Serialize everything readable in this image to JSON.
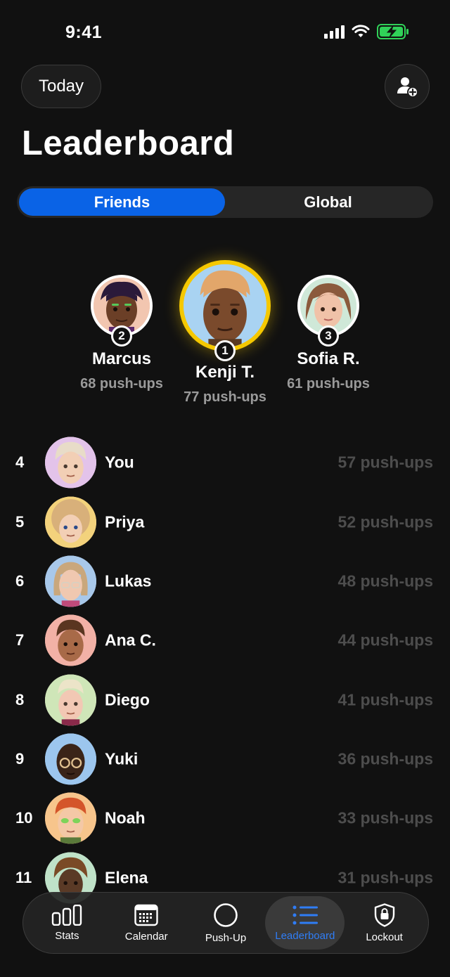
{
  "status_bar": {
    "time": "9:41"
  },
  "header": {
    "today_label": "Today",
    "title": "Leaderboard"
  },
  "segments": {
    "friends": "Friends",
    "global": "Global",
    "active": "Friends"
  },
  "podium": {
    "first": {
      "rank": "1",
      "name": "Kenji T.",
      "score": "77 push-ups"
    },
    "second": {
      "rank": "2",
      "name": "Marcus",
      "score": "68 push-ups"
    },
    "third": {
      "rank": "3",
      "name": "Sofia R.",
      "score": "61 push-ups"
    }
  },
  "list": [
    {
      "rank": "4",
      "name": "You",
      "score": "57 push-ups"
    },
    {
      "rank": "5",
      "name": "Priya",
      "score": "52 push-ups"
    },
    {
      "rank": "6",
      "name": "Lukas",
      "score": "48 push-ups"
    },
    {
      "rank": "7",
      "name": "Ana C.",
      "score": "44 push-ups"
    },
    {
      "rank": "8",
      "name": "Diego",
      "score": "41 push-ups"
    },
    {
      "rank": "9",
      "name": "Yuki",
      "score": "36 push-ups"
    },
    {
      "rank": "10",
      "name": "Noah",
      "score": "33 push-ups"
    },
    {
      "rank": "11",
      "name": "Elena",
      "score": "31 push-ups"
    }
  ],
  "tabs": [
    {
      "label": "Stats",
      "icon": "bar-chart-icon"
    },
    {
      "label": "Calendar",
      "icon": "calendar-icon"
    },
    {
      "label": "Push-Up",
      "icon": "circle-icon"
    },
    {
      "label": "Leaderboard",
      "icon": "list-icon",
      "active": true
    },
    {
      "label": "Lockout",
      "icon": "lock-shield-icon"
    }
  ],
  "colors": {
    "background": "#111111",
    "accent": "#0a63e6",
    "active_tab_label": "#2f7df6",
    "gold": "#f5c800",
    "battery": "#30d158"
  }
}
